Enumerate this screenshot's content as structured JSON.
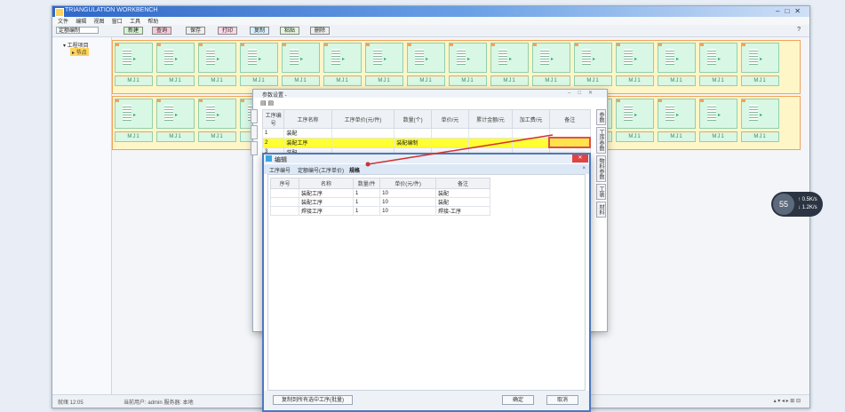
{
  "app": {
    "title": "TRIANGULATION WORKBENCH",
    "menu": [
      "文件",
      "编辑",
      "视图",
      "窗口",
      "工具",
      "帮助"
    ],
    "combo_value": "定额编制",
    "toolbar_buttons": [
      "新建",
      "查询",
      "保存",
      "打印",
      "复制",
      "粘贴",
      "删除"
    ],
    "toolbar_colors": [
      "#d6f5d0",
      "#f8c8d8",
      "#eeeeee",
      "#ffd6e6",
      "#d7f0ff",
      "#e2f7d8",
      "#eeeeee"
    ],
    "help_label": "?"
  },
  "sidebar": {
    "root": "▾ 工程项目",
    "child": "▸ 节点"
  },
  "grid": {
    "row1_count": 16,
    "row2_count": 16,
    "card_bottom": "MJ1"
  },
  "dialog_main": {
    "title": "参数设置 -",
    "toolbar": "▤ ▤",
    "columns": [
      "工序编号",
      "工序名称",
      "工序单价(元/件)",
      "数量(个)",
      "单价/元",
      "累计金额/元",
      "加工费/元",
      "备注"
    ],
    "rows": [
      [
        "1",
        "装配",
        "",
        "",
        "",
        "",
        "",
        ""
      ],
      [
        "2",
        "装配工序",
        "",
        "装配编制",
        "",
        "",
        "",
        ""
      ],
      [
        "3",
        "装配",
        "",
        "",
        "",
        "",
        "",
        ""
      ]
    ],
    "right_tabs": [
      "参数",
      "工序参数",
      "物料参数",
      "工装",
      "材料"
    ],
    "header_right": "工序编号"
  },
  "dialog_sub": {
    "title": "编辑",
    "tabs": [
      "工序编号",
      "定额编号(工序单价)",
      "规格"
    ],
    "close_label": "✕",
    "columns": [
      "序号",
      "名称",
      "数量/件",
      "单价(元/件)",
      "备注"
    ],
    "rows": [
      [
        "",
        "装配工序",
        "1",
        "10",
        "装配"
      ],
      [
        "",
        "装配工序",
        "1",
        "10",
        "装配"
      ],
      [
        "",
        "焊接工序",
        "1",
        "10",
        "焊接-工序"
      ]
    ],
    "bottom_left_button": "复制到所有选中工序(批量)",
    "ok_button": "确定",
    "cancel_button": "取消"
  },
  "statusbar": {
    "left": "就绪  12:05",
    "middle": "当前用户: admin    服务器: 本地",
    "right": "▴ ▾ ◂ ▸ ⊞ ⊟"
  },
  "widget": {
    "percent": "55",
    "line1": "↑ 0.5K/s",
    "line2": "↓ 1.2K/s"
  }
}
